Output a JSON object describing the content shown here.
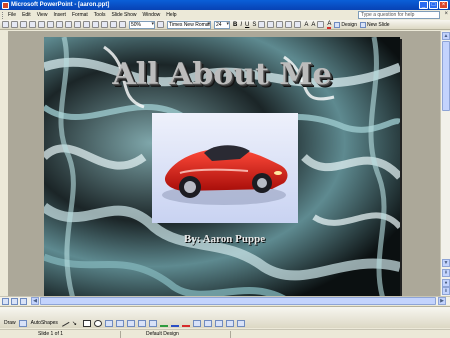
{
  "window": {
    "title": "Microsoft PowerPoint - [aaron.ppt]"
  },
  "menu": {
    "items": [
      "File",
      "Edit",
      "View",
      "Insert",
      "Format",
      "Tools",
      "Slide Show",
      "Window",
      "Help"
    ],
    "help_placeholder": "Type a question for help"
  },
  "toolbar": {
    "zoom": "50%",
    "font": "Times New Roman",
    "size": "24",
    "design_label": "Design",
    "new_slide_label": "New Slide"
  },
  "slide": {
    "title": "All About Me",
    "subtitle": "By: Aaron Puppe",
    "image": "sports-car-photo"
  },
  "drawing": {
    "draw_label": "Draw",
    "autoshapes_label": "AutoShapes",
    "fill_color": "#2e9b3e",
    "line_color": "#2c4fc4",
    "font_color": "#d62b2b"
  },
  "status": {
    "slide_indicator": "Slide 1 of 1",
    "design": "Default Design"
  }
}
